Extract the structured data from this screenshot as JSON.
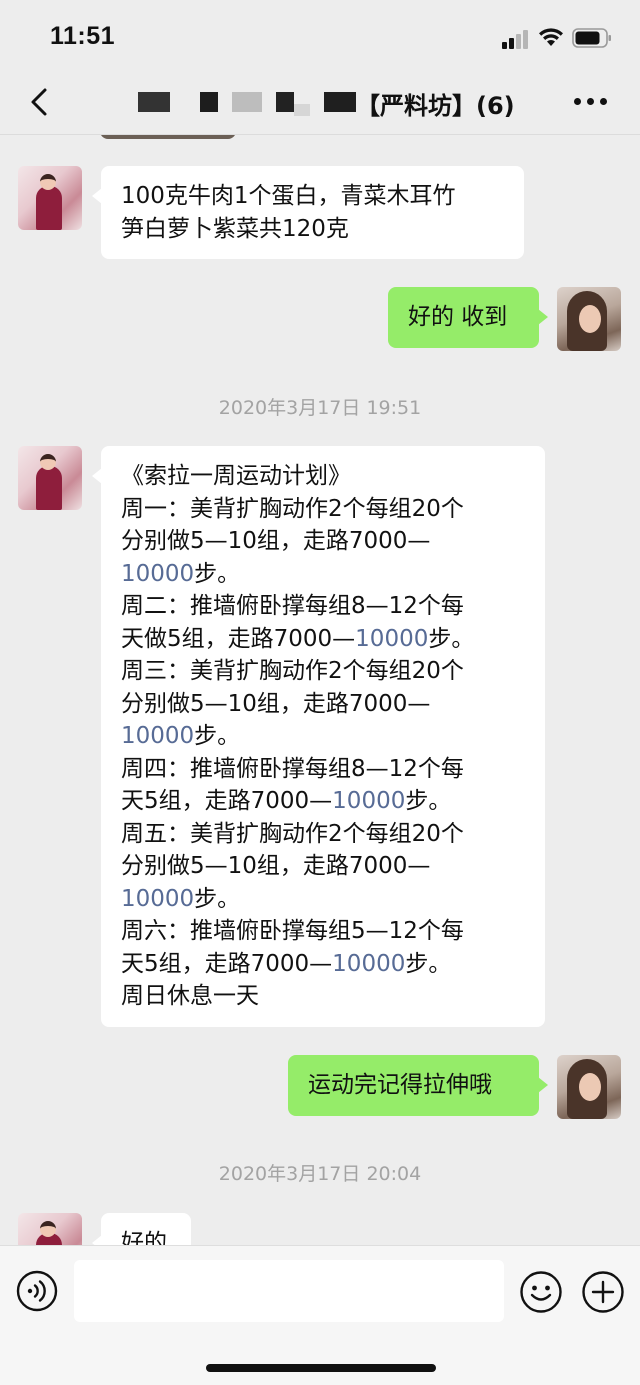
{
  "status_bar": {
    "time": "11:51"
  },
  "nav": {
    "title": "【严料坊】(6)"
  },
  "messages": [
    {
      "side": "left",
      "lines": [
        "100克牛肉1个蛋白，青菜木耳竹",
        "笋白萝卜紫菜共120克"
      ]
    },
    {
      "side": "right",
      "lines": [
        "好的 收到"
      ]
    },
    {
      "timestamp": "2020年3月17日 19:51"
    },
    {
      "side": "left",
      "lines": [
        "《索拉一周运动计划》",
        "周一：美背扩胸动作2个每组20个",
        "分别做5—10组，走路7000—",
        "10000步。",
        "周二：推墙俯卧撑每组8—12个每",
        "天做5组，走路7000—10000步。",
        "周三：美背扩胸动作2个每组20个",
        "分别做5—10组，走路7000—",
        "10000步。",
        "周四：推墙俯卧撑每组8—12个每",
        "天5组，走路7000—10000步。",
        "周五：美背扩胸动作2个每组20个",
        "分别做5—10组，走路7000—",
        "10000步。",
        "周六：推墙俯卧撑每组5—12个每",
        "天5组，走路7000—10000步。",
        "周日休息一天"
      ],
      "link_text": "10000",
      "link_color": "#576b95"
    },
    {
      "side": "right",
      "lines": [
        "运动完记得拉伸哦"
      ]
    },
    {
      "timestamp": "2020年3月17日 20:04"
    },
    {
      "side": "left",
      "lines": [
        "好的"
      ]
    }
  ],
  "input_bar": {
    "placeholder": "",
    "voice_icon": "voice-icon",
    "emoji_icon": "emoji-icon",
    "plus_icon": "plus-icon"
  },
  "colors": {
    "background": "#ededed",
    "bubble_self": "#95ec69",
    "bubble_other": "#ffffff",
    "timestamp": "#a3a3a3"
  }
}
